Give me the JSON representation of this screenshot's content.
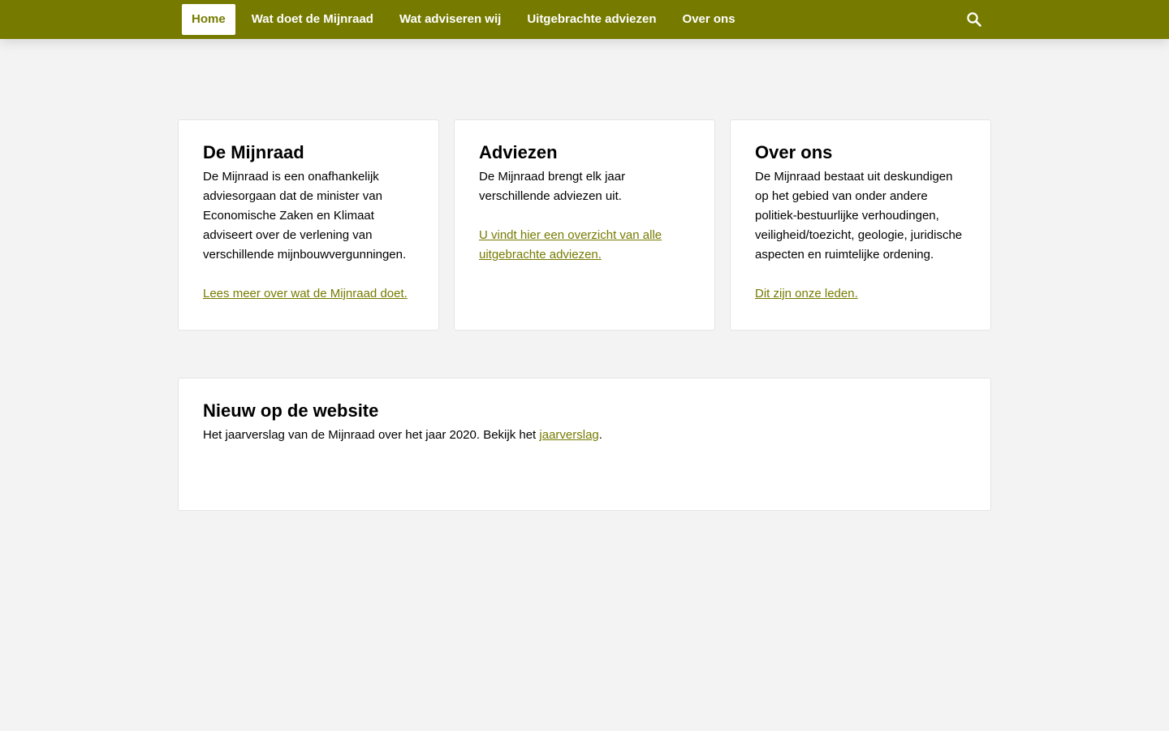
{
  "nav": {
    "items": [
      {
        "label": "Home",
        "active": true
      },
      {
        "label": "Wat doet de Mijnraad"
      },
      {
        "label": "Wat adviseren wij"
      },
      {
        "label": "Uitgebrachte adviezen"
      },
      {
        "label": "Over ons"
      }
    ],
    "search_icon": "search-icon"
  },
  "cards": [
    {
      "title": "De Mijnraad",
      "text": "De Mijnraad is een onafhankelijk adviesorgaan dat de minister van Economische Zaken en Klimaat adviseert over de verlening van verschillende mijnbouwvergunningen.",
      "link": "Lees meer over wat de Mijnraad doet."
    },
    {
      "title": "Adviezen",
      "text": "De Mijnraad brengt elk jaar verschillende adviezen uit.",
      "link": "U vindt hier een overzicht van alle uitgebrachte adviezen."
    },
    {
      "title": "Over ons",
      "text": "De Mijnraad bestaat uit deskundigen op het gebied van onder andere politiek-bestuurlijke verhoudingen, veiligheid/toezicht, geologie, juridische aspecten en ruimtelijke ordening.",
      "link": "Dit zijn onze leden."
    }
  ],
  "news": {
    "title": "Nieuw op de website",
    "text_before": "Het jaarverslag van de Mijnraad over het jaar 2020. Bekijk het ",
    "link": "jaarverslag",
    "text_after": "."
  },
  "colors": {
    "brand": "#767b00",
    "background": "#f3f3f3",
    "card": "#ffffff"
  }
}
